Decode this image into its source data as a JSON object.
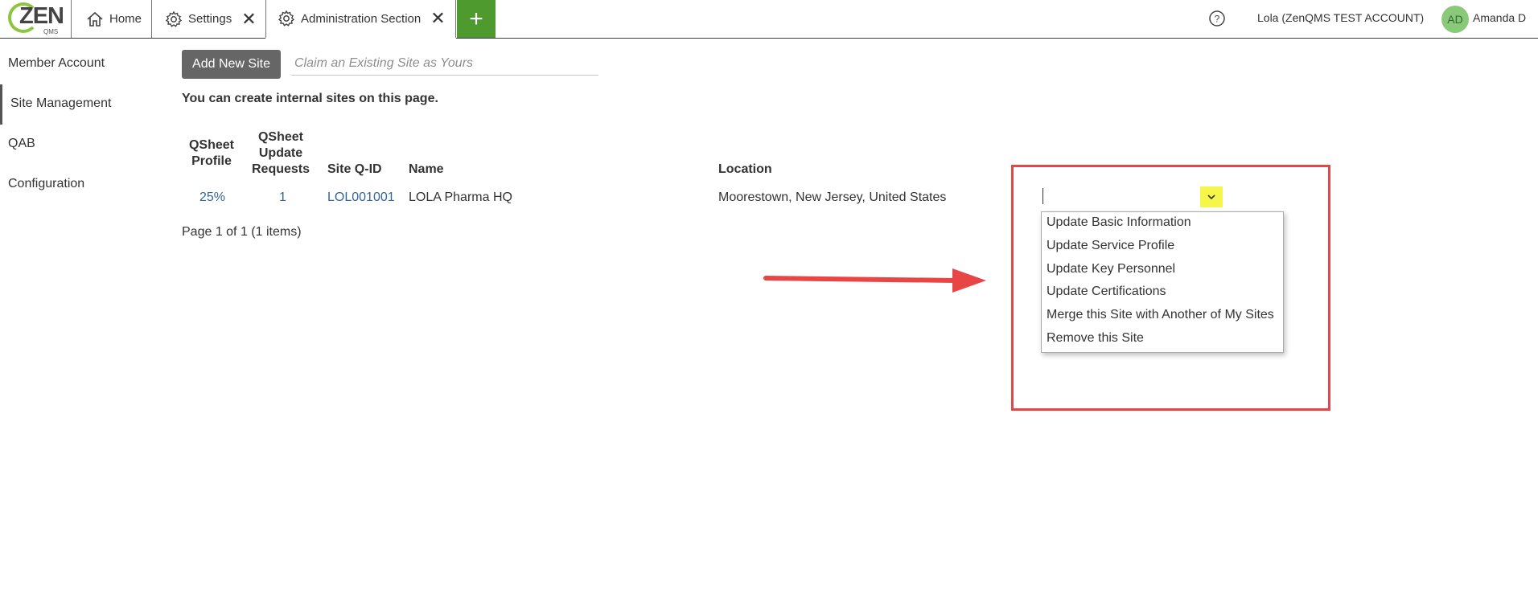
{
  "app": {
    "logo_text": "ZEN",
    "logo_sub": "QMS"
  },
  "tabs": [
    {
      "label": "Home",
      "icon": "home-icon"
    },
    {
      "label": "Settings",
      "icon": "gear-icon",
      "closable": true
    },
    {
      "label": "Administration Section",
      "icon": "gear-icon",
      "closable": true,
      "active": true
    }
  ],
  "add_tab_label": "+",
  "header": {
    "help_label": "?",
    "account": "Lola (ZenQMS TEST ACCOUNT)",
    "avatar_initials": "AD",
    "user_name": "Amanda D"
  },
  "sidebar": {
    "items": [
      {
        "label": "Member Account"
      },
      {
        "label": "Site Management",
        "active": true
      },
      {
        "label": "QAB"
      },
      {
        "label": "Configuration"
      }
    ]
  },
  "toolbar": {
    "add_label": "Add New Site",
    "claim_placeholder": "Claim an Existing Site as Yours"
  },
  "info_text": "You can create internal sites on this page.",
  "table": {
    "headers": {
      "qsheet_profile": [
        "QSheet",
        "Profile"
      ],
      "qsheet_update": [
        "QSheet",
        "Update",
        "Requests"
      ],
      "site_qid": "Site Q-ID",
      "name": "Name",
      "location": "Location"
    },
    "rows": [
      {
        "qsheet_profile": "25%",
        "update_requests": "1",
        "site_qid": "LOL001001",
        "name": "LOLA Pharma HQ",
        "location": "Moorestown, New Jersey, United States"
      }
    ],
    "pager": "Page 1 of 1 (1 items)"
  },
  "action_menu": {
    "options": [
      "Update Basic Information",
      "Update Service Profile",
      "Update Key Personnel",
      "Update Certifications",
      "Merge this Site with Another of My Sites",
      "Remove this Site"
    ]
  },
  "colors": {
    "accent_green": "#4f9a2f",
    "link_blue": "#336699",
    "highlight_yellow": "#f5f54a",
    "annotation_red": "#e84545",
    "button_gray": "#666666"
  }
}
